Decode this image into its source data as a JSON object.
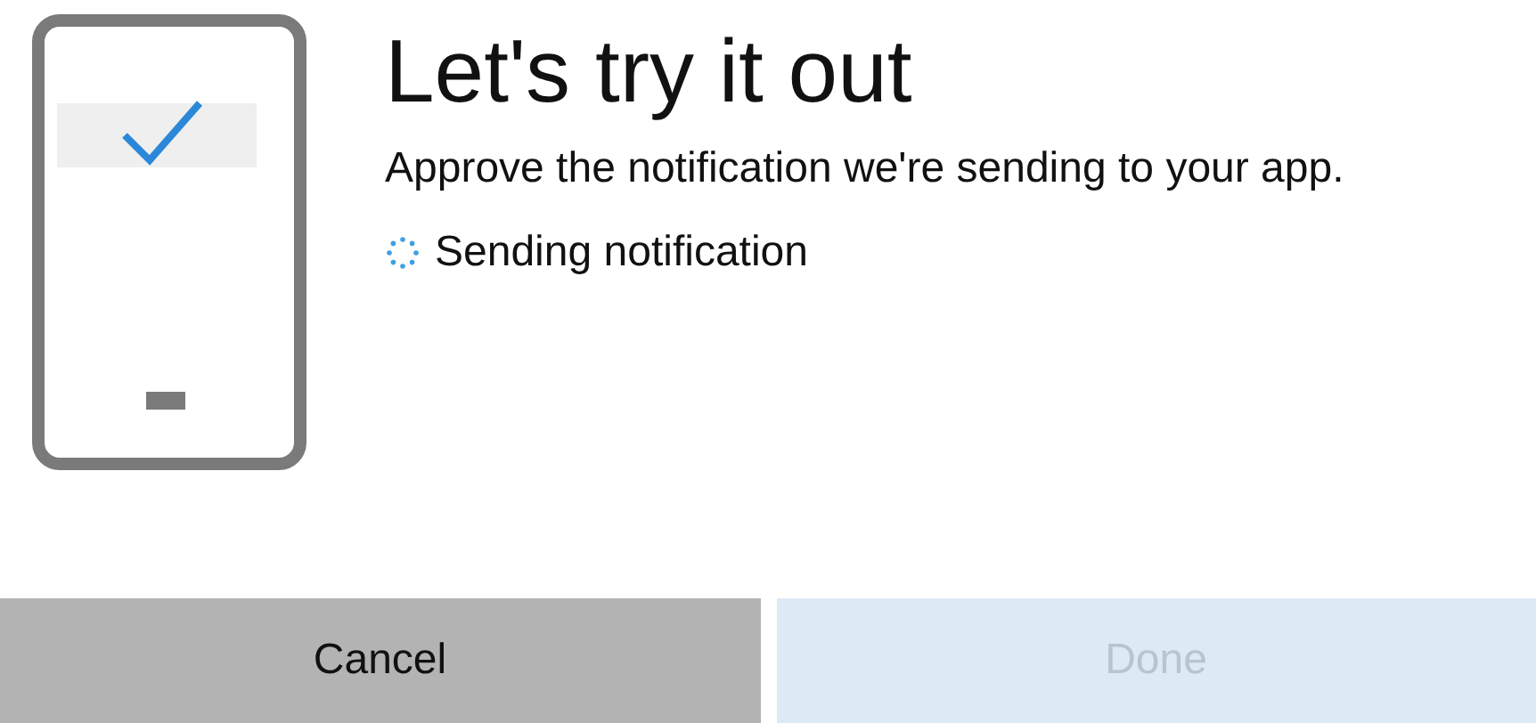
{
  "title": "Let's try it out",
  "message": "Approve the notification we're sending to your app.",
  "status": {
    "text": "Sending notification",
    "busy": true
  },
  "buttons": [
    {
      "label": "Cancel",
      "disabled": false
    },
    {
      "label": "Done",
      "disabled": true
    }
  ]
}
